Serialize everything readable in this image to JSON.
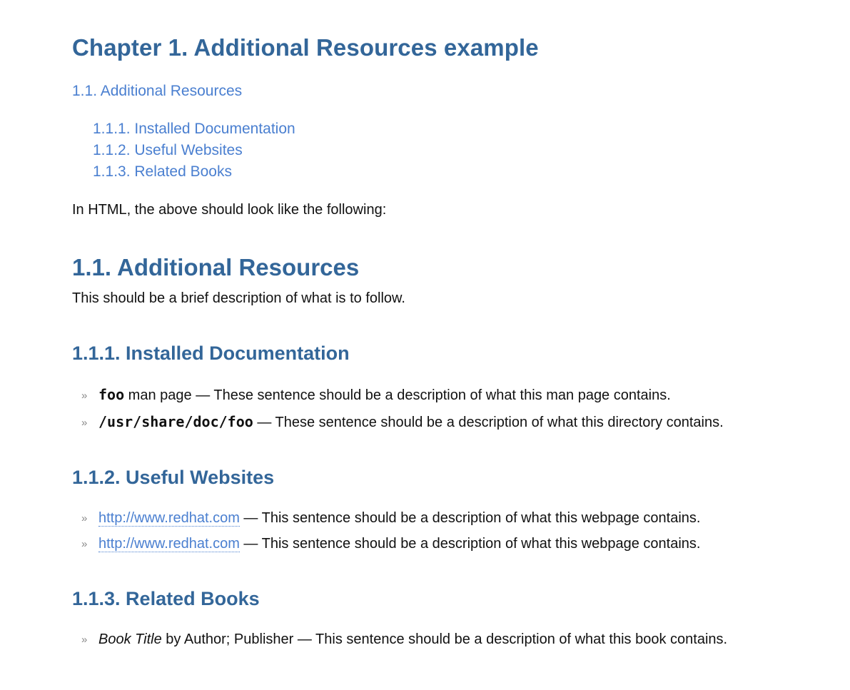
{
  "chapter": {
    "title": "Chapter 1. Additional Resources example"
  },
  "toc": {
    "section": "1.1. Additional Resources",
    "subsections": [
      "1.1.1. Installed Documentation",
      "1.1.2. Useful Websites",
      "1.1.3. Related Books"
    ]
  },
  "intro": "In HTML, the above should look like the following:",
  "section": {
    "title": "1.1. Additional Resources",
    "description": "This should be a brief description of what is to follow."
  },
  "installed_docs": {
    "title": "1.1.1. Installed Documentation",
    "items": [
      {
        "name": "foo",
        "suffix": " man page — These sentence should be a description of what this man page contains."
      },
      {
        "path_parts": [
          "/",
          "usr",
          "/",
          "share",
          "/",
          "doc",
          "/",
          "foo"
        ],
        "suffix": " — These sentence should be a description of what this directory contains."
      }
    ]
  },
  "websites": {
    "title": "1.1.2. Useful Websites",
    "items": [
      {
        "url": "http://www.redhat.com",
        "suffix": " — This sentence should be a description of what this webpage contains."
      },
      {
        "url": "http://www.redhat.com",
        "suffix": " — This sentence should be a description of what this webpage contains."
      }
    ]
  },
  "books": {
    "title": "1.1.3. Related Books",
    "items": [
      {
        "book_title": "Book Title",
        "suffix": " by Author; Publisher — This sentence should be a description of what this book contains."
      }
    ]
  },
  "icons": {
    "bullet": "double-chevron-right-icon"
  },
  "colors": {
    "heading": "#336699",
    "link": "#4a7fd0",
    "text": "#111111"
  }
}
